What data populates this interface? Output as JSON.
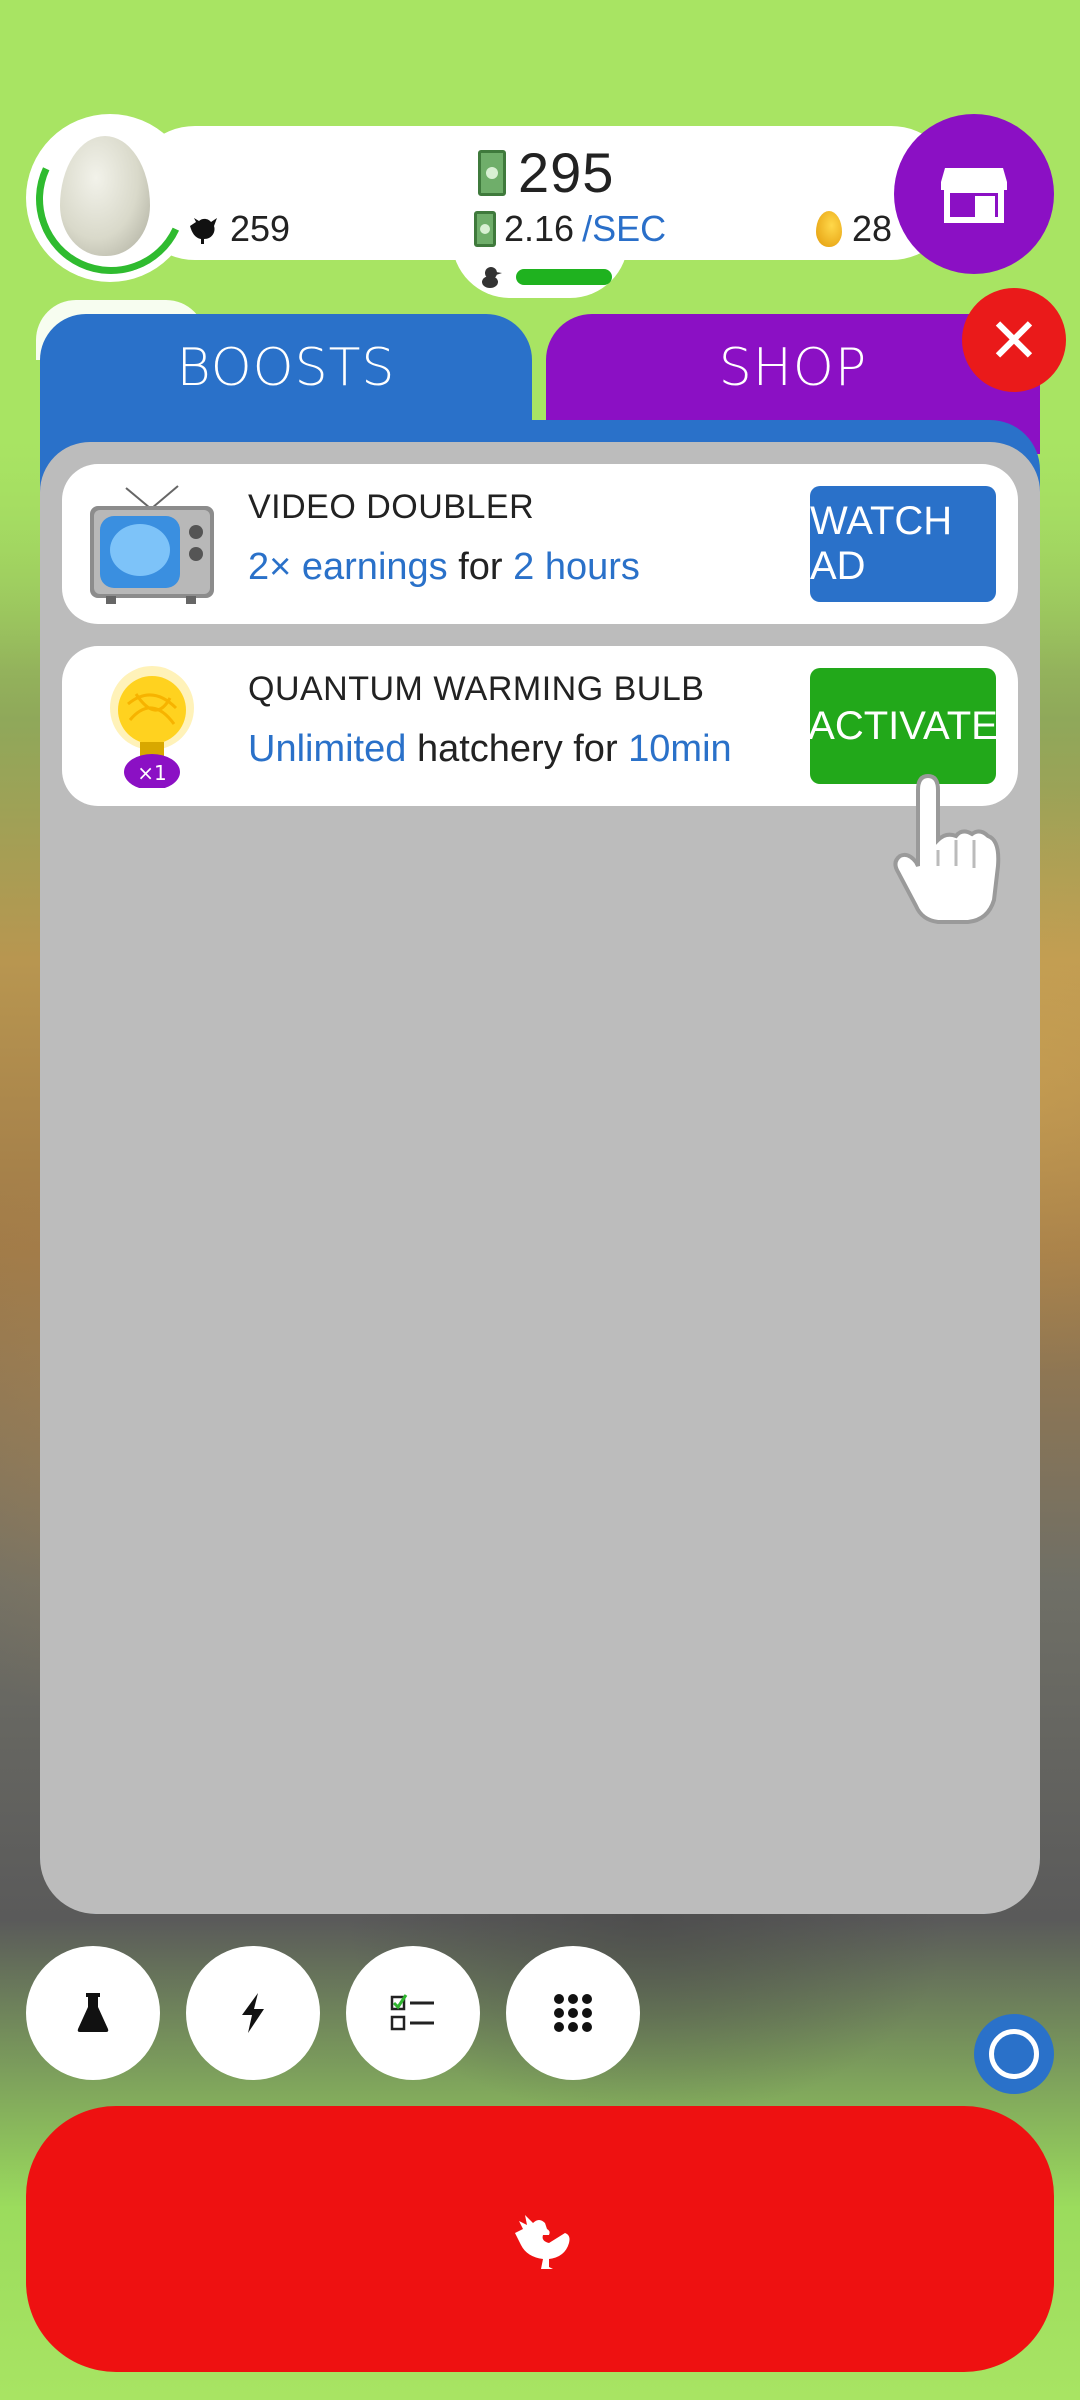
{
  "hud": {
    "money": "295",
    "rate_value": "2.16",
    "rate_unit": "/SEC",
    "chickens": "259",
    "golden_eggs": "28"
  },
  "tabs": [
    {
      "label": "BOOSTS"
    },
    {
      "label": "SHOP"
    }
  ],
  "boosts": [
    {
      "title": "VIDEO DOUBLER",
      "desc_parts": [
        "2× earnings",
        " for ",
        "2 hours"
      ],
      "button": "WATCH AD",
      "icon": "tv-icon"
    },
    {
      "title": "QUANTUM WARMING BULB",
      "desc_parts": [
        "Unlimited",
        " hatchery for ",
        "10min"
      ],
      "button": "ACTIVATE",
      "icon": "bulb-icon",
      "count_badge": "×1"
    }
  ],
  "colors": {
    "background_green": "#a8e463",
    "boosts_blue": "#2a71c9",
    "shop_purple": "#8b10c4",
    "close_red": "#ea1a1a",
    "activate_green": "#22a81a",
    "hatch_red": "#ee1111"
  },
  "bottom_icons": [
    "flask-icon",
    "lightning-icon",
    "checklist-icon",
    "grid-icon"
  ]
}
